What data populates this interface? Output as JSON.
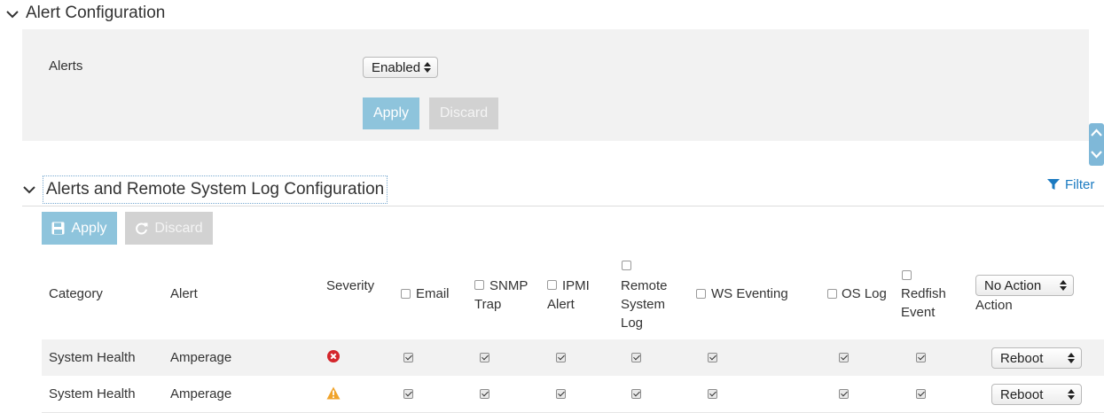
{
  "alert_config": {
    "title": "Alert Configuration",
    "alerts_label": "Alerts",
    "alerts_value": "Enabled",
    "apply_label": "Apply",
    "discard_label": "Discard"
  },
  "log_config": {
    "title": "Alerts and Remote System Log Configuration",
    "filter_label": "Filter",
    "apply_label": "Apply",
    "discard_label": "Discard",
    "columns": {
      "category": "Category",
      "alert": "Alert",
      "severity": "Severity",
      "email": "Email",
      "snmp_1": "SNMP",
      "snmp_2": "Trap",
      "ipmi_1": "IPMI",
      "ipmi_2": "Alert",
      "remote_1": "Remote",
      "remote_2": "System",
      "remote_3": "Log",
      "ws": "WS Eventing",
      "oslog": "OS Log",
      "redfish_1": "Redfish",
      "redfish_2": "Event",
      "action_select": "No Action",
      "action": "Action"
    },
    "rows": [
      {
        "category": "System Health",
        "alert": "Amperage",
        "severity": "critical-icon",
        "action": "Reboot",
        "checked": [
          true,
          true,
          true,
          true,
          true,
          true,
          true
        ]
      },
      {
        "category": "System Health",
        "alert": "Amperage",
        "severity": "warning-icon",
        "action": "Reboot",
        "checked": [
          true,
          true,
          true,
          true,
          true,
          true,
          true
        ]
      }
    ]
  },
  "colors": {
    "accent": "#1a7ac1",
    "apply_button": "#8ec4dc",
    "discard_button": "#d2d2d2",
    "critical": "#d4262c",
    "warning": "#f0a32a",
    "row_alt": "#f2f2f2"
  }
}
